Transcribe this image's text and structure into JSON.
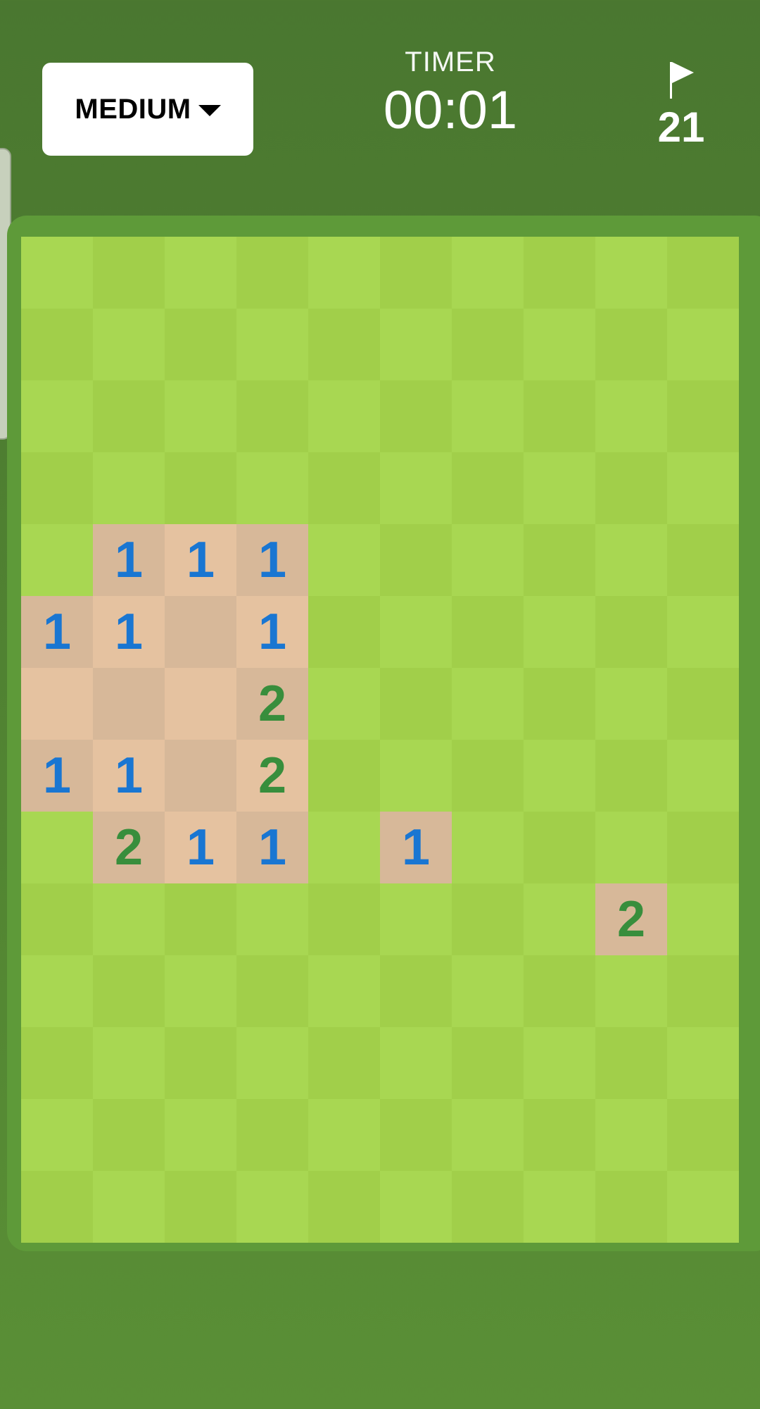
{
  "header": {
    "difficulty": "MEDIUM",
    "timer_label": "TIMER",
    "timer_value": "00:01",
    "flag_count": "21"
  },
  "icons": {
    "caret": "caret-down-icon",
    "flag": "flag-icon"
  },
  "colors": {
    "grass_light": "#a8d752",
    "grass_dark": "#a1cf4a",
    "revealed_light": "#e5c2a0",
    "revealed_dark": "#d7b899",
    "number_1": "#1976d2",
    "number_2": "#388e3c"
  },
  "board": {
    "cols": 10,
    "rows": 14,
    "cells": [
      "..........",
      "..........",
      "..........",
      "..........",
      ".111......",
      "1101......",
      "0002......",
      "1102......",
      ".211.1....",
      "........2.",
      "..........",
      "..........",
      "..........",
      ".........."
    ]
  }
}
